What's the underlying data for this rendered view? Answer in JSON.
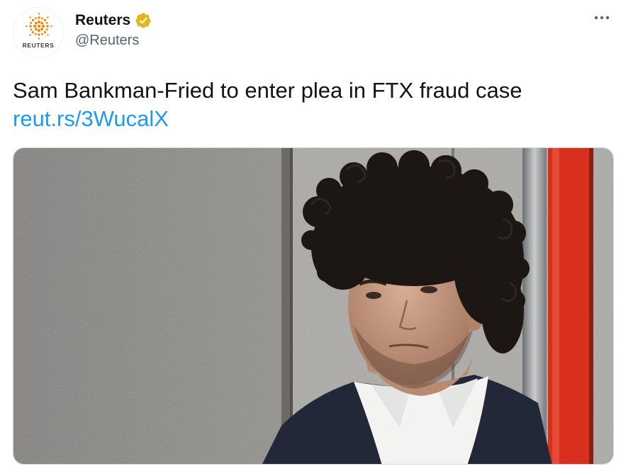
{
  "account": {
    "display_name": "Reuters",
    "handle": "@Reuters",
    "avatar_wordmark": "REUTERS",
    "verified": true,
    "verified_color": "#e2b719"
  },
  "tweet": {
    "text": "Sam Bankman-Fried to enter plea in FTX fraud case",
    "link": "reut.rs/3WucalX"
  },
  "icons": {
    "more": "more-horizontal-icon",
    "verified": "verified-badge-icon",
    "logo": "reuters-logo-icon"
  },
  "colors": {
    "link": "#1d9bf0",
    "text": "#0f1419",
    "secondary": "#536471",
    "reuters_orange": "#ff8000"
  }
}
